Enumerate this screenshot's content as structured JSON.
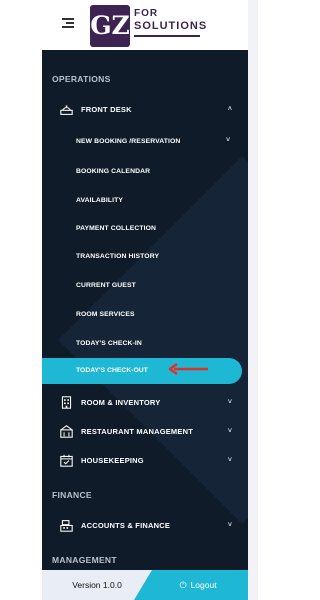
{
  "brand": {
    "mark": "GZ",
    "line1": "FOR",
    "line2": "SOLUTIONS",
    "colors": {
      "mark_bg": "#3c2352"
    }
  },
  "sidebar": {
    "colors": {
      "background": "#0f1b28",
      "active": "#1eb8d4",
      "arrow": "#e0302a"
    },
    "sections": {
      "operations": "OPERATIONS",
      "finance": "FINANCE",
      "management": "MANAGEMENT"
    },
    "front_desk": {
      "label": "FRONT DESK",
      "icon": "desk-bell-icon",
      "expanded": true,
      "children": [
        {
          "label": "NEW BOOKING /RESERVATION",
          "has_submenu": true
        },
        {
          "label": "BOOKING CALENDAR"
        },
        {
          "label": "AVAILABILITY"
        },
        {
          "label": "PAYMENT COLLECTION"
        },
        {
          "label": "TRANSACTION HISTORY"
        },
        {
          "label": "CURRENT GUEST"
        },
        {
          "label": "ROOM SERVICES"
        },
        {
          "label": "TODAY'S CHECK-IN"
        },
        {
          "label": "TODAY'S CHECK-OUT",
          "active": true
        }
      ]
    },
    "room_inventory": {
      "label": "ROOM & INVENTORY",
      "icon": "building-icon"
    },
    "restaurant": {
      "label": "RESTAURANT MANAGEMENT",
      "icon": "restaurant-icon"
    },
    "housekeeping": {
      "label": "HOUSEKEEPING",
      "icon": "calendar-icon"
    },
    "accounts": {
      "label": "ACCOUNTS & FINANCE",
      "icon": "cash-register-icon"
    }
  },
  "footer": {
    "version": "Version 1.0.0",
    "logout": "Logout",
    "logout_icon": "power-icon"
  }
}
